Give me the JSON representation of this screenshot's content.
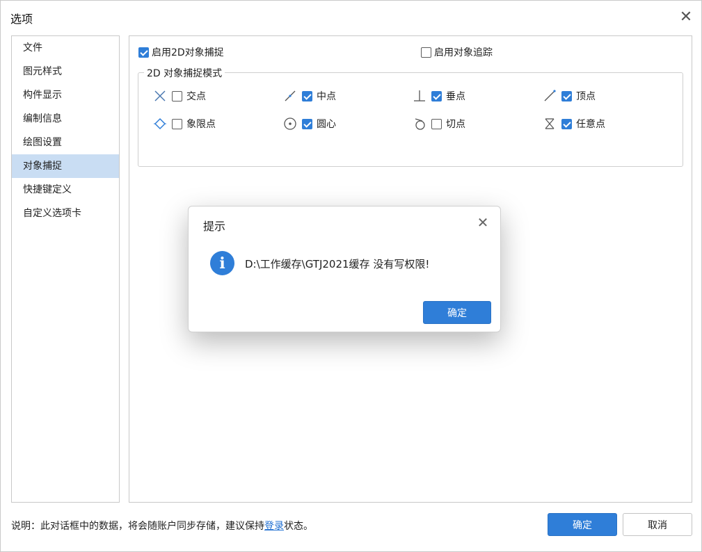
{
  "window": {
    "title": "选项"
  },
  "sidebar": {
    "items": [
      {
        "label": "文件"
      },
      {
        "label": "图元样式"
      },
      {
        "label": "构件显示"
      },
      {
        "label": "编制信息"
      },
      {
        "label": "绘图设置"
      },
      {
        "label": "对象捕捉",
        "active": true
      },
      {
        "label": "快捷键定义"
      },
      {
        "label": "自定义选项卡"
      }
    ]
  },
  "content": {
    "enable_2d_snap": {
      "label": "启用2D对象捕捉",
      "checked": true
    },
    "enable_tracking": {
      "label": "启用对象追踪",
      "checked": false
    },
    "group_title": "2D 对象捕捉模式",
    "snaps": [
      {
        "label": "交点",
        "icon": "intersection-icon",
        "checked": false
      },
      {
        "label": "中点",
        "icon": "midpoint-icon",
        "checked": true
      },
      {
        "label": "垂点",
        "icon": "perpendicular-icon",
        "checked": true
      },
      {
        "label": "顶点",
        "icon": "endpoint-icon",
        "checked": true
      },
      {
        "label": "象限点",
        "icon": "quadrant-icon",
        "checked": false
      },
      {
        "label": "圆心",
        "icon": "center-icon",
        "checked": true
      },
      {
        "label": "切点",
        "icon": "tangent-icon",
        "checked": false
      },
      {
        "label": "任意点",
        "icon": "nearest-icon",
        "checked": true
      }
    ]
  },
  "footer": {
    "note_prefix": "说明：此对话框中的数据，将会随账户同步存储，建议保持",
    "note_link": "登录",
    "note_suffix": "状态。",
    "ok_label": "确定",
    "cancel_label": "取消"
  },
  "modal": {
    "title": "提示",
    "message": "D:\\工作缓存\\GTJ2021缓存 没有写权限!",
    "ok_label": "确定"
  },
  "colors": {
    "accent": "#2f7ed8",
    "sidebar_active": "#c9ddf3"
  }
}
